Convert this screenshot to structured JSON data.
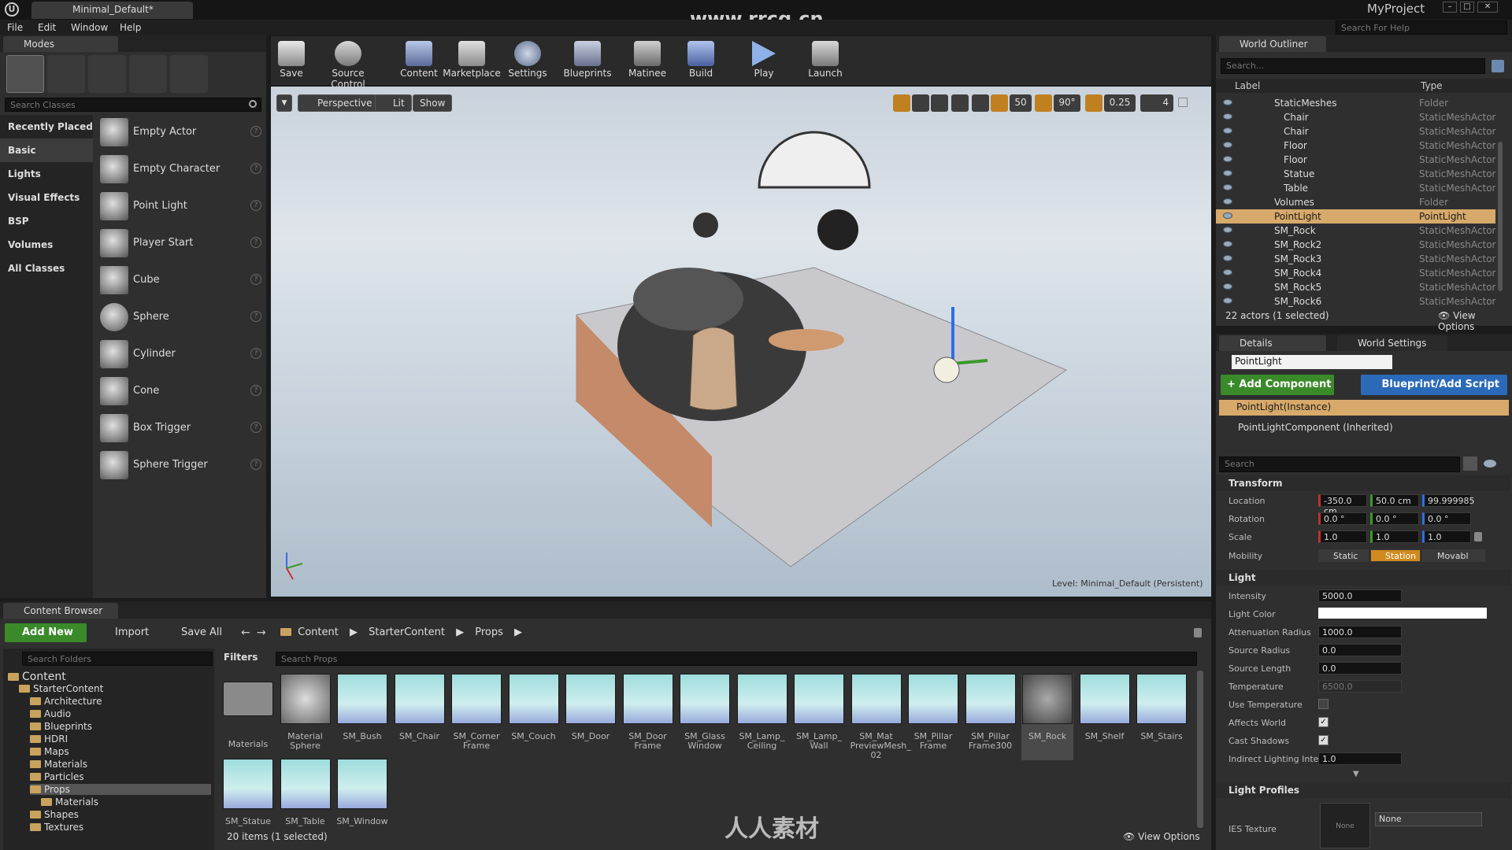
{
  "window": {
    "tab_title": "Minimal_Default*",
    "project": "MyProject",
    "search_help_placeholder": "Search For Help",
    "watermark_top": "www.rrcg.cn"
  },
  "menu": [
    "File",
    "Edit",
    "Window",
    "Help"
  ],
  "modes": {
    "tab": "Modes",
    "search_placeholder": "Search Classes",
    "categories": [
      "Recently Placed",
      "Basic",
      "Lights",
      "Visual Effects",
      "BSP",
      "Volumes",
      "All Classes"
    ],
    "items": [
      "Empty Actor",
      "Empty Character",
      "Point Light",
      "Player Start",
      "Cube",
      "Sphere",
      "Cylinder",
      "Cone",
      "Box Trigger",
      "Sphere Trigger"
    ]
  },
  "toolbar": [
    "Save",
    "Source Control",
    "Content",
    "Marketplace",
    "Settings",
    "Blueprints",
    "Matinee",
    "Build",
    "Play",
    "Launch"
  ],
  "viewport": {
    "perspective": "Perspective",
    "lit": "Lit",
    "show": "Show",
    "grid": "50",
    "angle": "90°",
    "scale": "0.25",
    "speed": "4",
    "level_label": "Level:",
    "level_name": "Minimal_Default (Persistent)"
  },
  "outliner": {
    "tab": "World Outliner",
    "search_placeholder": "Search...",
    "col_label": "Label",
    "col_type": "Type",
    "rows": [
      {
        "name": "StaticMeshes",
        "type": "Folder"
      },
      {
        "name": "Chair",
        "type": "StaticMeshActor"
      },
      {
        "name": "Chair",
        "type": "StaticMeshActor"
      },
      {
        "name": "Floor",
        "type": "StaticMeshActor"
      },
      {
        "name": "Floor",
        "type": "StaticMeshActor"
      },
      {
        "name": "Statue",
        "type": "StaticMeshActor"
      },
      {
        "name": "Table",
        "type": "StaticMeshActor"
      },
      {
        "name": "Volumes",
        "type": "Folder"
      },
      {
        "name": "PointLight",
        "type": "PointLight"
      },
      {
        "name": "SM_Rock",
        "type": "StaticMeshActor"
      },
      {
        "name": "SM_Rock2",
        "type": "StaticMeshActor"
      },
      {
        "name": "SM_Rock3",
        "type": "StaticMeshActor"
      },
      {
        "name": "SM_Rock4",
        "type": "StaticMeshActor"
      },
      {
        "name": "SM_Rock5",
        "type": "StaticMeshActor"
      },
      {
        "name": "SM_Rock6",
        "type": "StaticMeshActor"
      }
    ],
    "status": "22 actors (1 selected)",
    "view_options": "View Options"
  },
  "details": {
    "tab": "Details",
    "tab2": "World Settings",
    "name_value": "PointLight",
    "add_component": "+ Add Component",
    "blueprint": "Blueprint/Add Script",
    "instance": "PointLight(Instance)",
    "component": "PointLightComponent (Inherited)",
    "search_placeholder": "Search",
    "transform": {
      "header": "Transform",
      "location_label": "Location",
      "rotation_label": "Rotation",
      "scale_label": "Scale",
      "mobility_label": "Mobility",
      "location": [
        "-350.0 cm",
        "50.0 cm",
        "99.999985"
      ],
      "rotation": [
        "0.0 °",
        "0.0 °",
        "0.0 °"
      ],
      "scale": [
        "1.0",
        "1.0",
        "1.0"
      ],
      "mobility": [
        "Static",
        "Station",
        "Movabl"
      ]
    },
    "light": {
      "header": "Light",
      "intensity_label": "Intensity",
      "intensity": "5000.0",
      "color_label": "Light Color",
      "atten_label": "Attenuation Radius",
      "atten": "1000.0",
      "src_radius_label": "Source Radius",
      "src_radius": "0.0",
      "src_len_label": "Source Length",
      "src_len": "0.0",
      "temp_label": "Temperature",
      "temp": "6500.0",
      "use_temp_label": "Use Temperature",
      "affects_label": "Affects World",
      "shadows_label": "Cast Shadows",
      "indirect_label": "Indirect Lighting Inter",
      "indirect": "1.0"
    },
    "profiles": {
      "header": "Light Profiles",
      "ies_label": "IES Texture",
      "thumb": "None",
      "select": "None"
    }
  },
  "content_browser": {
    "tab": "Content Browser",
    "add_new": "Add New",
    "import": "Import",
    "save_all": "Save All",
    "path": [
      "Content",
      "StarterContent",
      "Props"
    ],
    "search_folders": "Search Folders",
    "filters": "Filters",
    "search_props": "Search Props",
    "tree": [
      {
        "name": "Content",
        "indent": 0
      },
      {
        "name": "StarterContent",
        "indent": 1
      },
      {
        "name": "Architecture",
        "indent": 2
      },
      {
        "name": "Audio",
        "indent": 2
      },
      {
        "name": "Blueprints",
        "indent": 2
      },
      {
        "name": "HDRI",
        "indent": 2
      },
      {
        "name": "Maps",
        "indent": 2
      },
      {
        "name": "Materials",
        "indent": 2
      },
      {
        "name": "Particles",
        "indent": 2
      },
      {
        "name": "Props",
        "indent": 2
      },
      {
        "name": "Materials",
        "indent": 3
      },
      {
        "name": "Shapes",
        "indent": 2
      },
      {
        "name": "Textures",
        "indent": 2
      }
    ],
    "assets": [
      "Materials",
      "Material Sphere",
      "SM_Bush",
      "SM_Chair",
      "SM_Corner Frame",
      "SM_Couch",
      "SM_Door",
      "SM_Door Frame",
      "SM_Glass Window",
      "SM_Lamp_ Ceiling",
      "SM_Lamp_ Wall",
      "SM_Mat PreviewMesh_ 02",
      "SM_Pillar Frame",
      "SM_Pillar Frame300",
      "SM_Rock",
      "SM_Shelf",
      "SM_Stairs",
      "SM_Statue",
      "SM_Table",
      "SM_Window"
    ],
    "status": "20 items (1 selected)",
    "view_options": "View Options"
  },
  "watermark_bottom": "人人素材"
}
